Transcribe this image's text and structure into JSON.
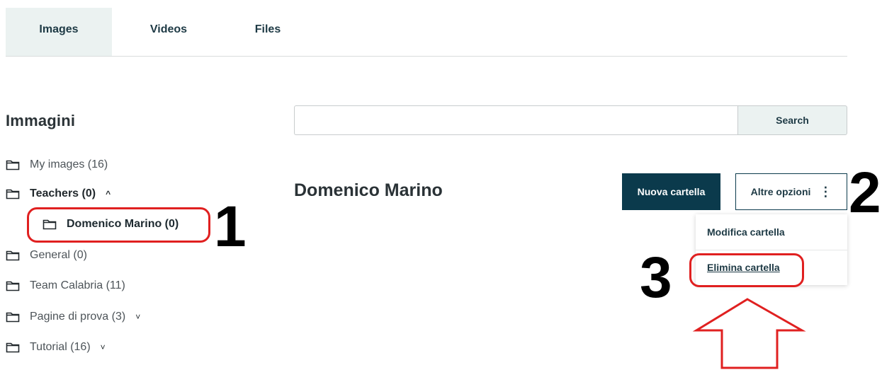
{
  "tabs": [
    {
      "label": "Images",
      "active": true
    },
    {
      "label": "Videos",
      "active": false
    },
    {
      "label": "Files",
      "active": false
    }
  ],
  "sidebar": {
    "title": "Immagini",
    "items": [
      {
        "label": "My images (16)",
        "bold": false,
        "chevron": ""
      },
      {
        "label": "Teachers (0)",
        "bold": true,
        "chevron": "^"
      },
      {
        "label": "Domenico Marino (0)",
        "bold": true,
        "chevron": ""
      },
      {
        "label": "General (0)",
        "bold": false,
        "chevron": ""
      },
      {
        "label": "Team Calabria (11)",
        "bold": false,
        "chevron": ""
      },
      {
        "label": "Pagine di prova (3)",
        "bold": false,
        "chevron": "˅"
      },
      {
        "label": "Tutorial (16)",
        "bold": false,
        "chevron": "˅"
      }
    ]
  },
  "search": {
    "placeholder": "",
    "button_label": "Search"
  },
  "main": {
    "folder_title": "Domenico Marino",
    "new_folder_label": "Nuova cartella",
    "more_options_label": "Altre opzioni",
    "more_options_icon": "⋮",
    "menu": {
      "edit_label": "Modifica cartella",
      "delete_label": "Elimina cartella"
    }
  },
  "annotations": {
    "step1": "1",
    "step2": "2",
    "step3": "3"
  },
  "colors": {
    "accent_dark": "#0b3a4c",
    "tab_active_bg": "#ebf2f1",
    "annotation_red": "#e02020"
  }
}
